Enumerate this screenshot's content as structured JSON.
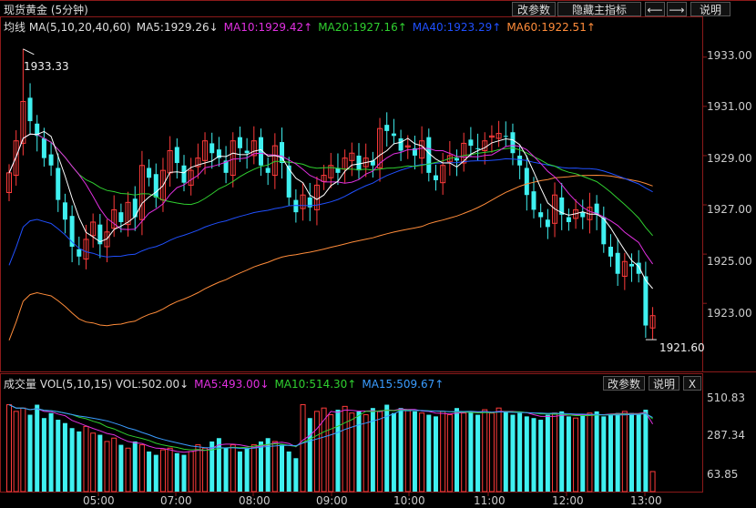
{
  "header": {
    "title": "现货黄金 (5分钟)"
  },
  "toolbar": {
    "modify_params": "改参数",
    "hide_indicators": "隐藏主指标",
    "left_arrow": "⟵",
    "right_arrow": "⟶",
    "explain": "说明"
  },
  "main_legend": {
    "prefix": "均线 MA(5,10,20,40,60)",
    "ma5": "MA5:1929.26↓",
    "ma10": "MA10:1929.42↑",
    "ma20": "MA20:1927.16↑",
    "ma40": "MA40:1923.29↑",
    "ma60": "MA60:1922.51↑"
  },
  "volume_legend": {
    "prefix": "成交量 VOL(5,10,15) VOL:502.00↓",
    "ma5": "MA5:493.00↓",
    "ma10": "MA10:514.30↑",
    "ma15": "MA15:509.67↑"
  },
  "volume_toolbar": {
    "modify_params": "改参数",
    "explain": "说明",
    "close": "X"
  },
  "annotations": {
    "high": "1933.33",
    "low": "1921.60"
  },
  "colors": {
    "up": "#ff3b3b",
    "down": "#3ff0f0",
    "ma5": "#ffffff",
    "ma10": "#e030e0",
    "ma20": "#30d030",
    "ma40": "#2050ff",
    "ma60": "#ff8c3a"
  },
  "chart_data": [
    {
      "type": "candlestick",
      "title": "现货黄金 (5分钟)",
      "y_ticks": [
        "1933.00",
        "1931.00",
        "1929.00",
        "1927.00",
        "1925.00",
        "1923.00"
      ],
      "ylim": [
        1920.9,
        1934.1
      ],
      "x_ticks": [
        "05:00",
        "07:00",
        "08:00",
        "09:00",
        "10:00",
        "11:00",
        "12:00",
        "13:00"
      ],
      "high": 1933.33,
      "low": 1921.6,
      "closes": [
        1928.3,
        1929.6,
        1931.2,
        1930.4,
        1929.8,
        1928.9,
        1928.6,
        1927.2,
        1926.4,
        1925.3,
        1924.9,
        1925.6,
        1926.3,
        1925.4,
        1925.9,
        1926.8,
        1926.3,
        1927.1,
        1926.5,
        1928.6,
        1928.1,
        1927.3,
        1928.4,
        1929.2,
        1928.7,
        1927.9,
        1928.4,
        1928.9,
        1929.6,
        1929.1,
        1928.9,
        1928.3,
        1929.6,
        1929.3,
        1929.1,
        1929.6,
        1928.6,
        1928.3,
        1929.4,
        1928.7,
        1927.3,
        1926.7,
        1927.4,
        1926.9,
        1927.8,
        1928.2,
        1928.6,
        1928.3,
        1928.9,
        1929.1,
        1928.4,
        1928.9,
        1928.6,
        1930.1,
        1930.0,
        1929.8,
        1929.2,
        1929.4,
        1929.0,
        1929.6,
        1928.3,
        1928.0,
        1928.6,
        1929.0,
        1928.8,
        1929.5,
        1929.4,
        1929.3,
        1929.6,
        1929.8,
        1929.9,
        1929.8,
        1929.1,
        1928.6,
        1927.4,
        1926.8,
        1926.5,
        1926.1,
        1927.4,
        1926.6,
        1926.3,
        1926.8,
        1926.5,
        1926.9,
        1926.6,
        1925.4,
        1924.9,
        1924.2,
        1924.7,
        1924.5,
        1924.2,
        1922.1,
        1922.5
      ],
      "ma_values_last": {
        "MA5": 1929.26,
        "MA10": 1929.42,
        "MA20": 1927.16,
        "MA40": 1923.29,
        "MA60": 1922.51
      }
    },
    {
      "type": "bar",
      "title": "成交量 VOL(5,10,15)",
      "y_ticks": [
        "510.83",
        "287.34",
        "63.85"
      ],
      "ylim": [
        0,
        610
      ],
      "last": {
        "VOL": 502.0,
        "MA5": 493.0,
        "MA10": 514.3,
        "MA15": 509.67
      },
      "volumes": [
        520,
        480,
        500,
        460,
        520,
        440,
        470,
        430,
        410,
        380,
        360,
        390,
        350,
        340,
        300,
        320,
        280,
        260,
        300,
        280,
        240,
        220,
        250,
        260,
        230,
        220,
        240,
        280,
        260,
        300,
        320,
        260,
        280,
        240,
        260,
        280,
        300,
        320,
        300,
        280,
        240,
        200,
        520,
        440,
        480,
        500,
        460,
        490,
        510,
        470,
        480,
        460,
        500,
        480,
        520,
        470,
        500,
        490,
        480,
        470,
        460,
        450,
        480,
        460,
        500,
        470,
        480,
        460,
        490,
        470,
        500,
        480,
        460,
        470,
        450,
        440,
        430,
        460,
        470,
        480,
        450,
        440,
        460,
        470,
        480,
        450,
        460,
        470,
        480,
        470,
        460,
        490,
        120
      ]
    }
  ]
}
